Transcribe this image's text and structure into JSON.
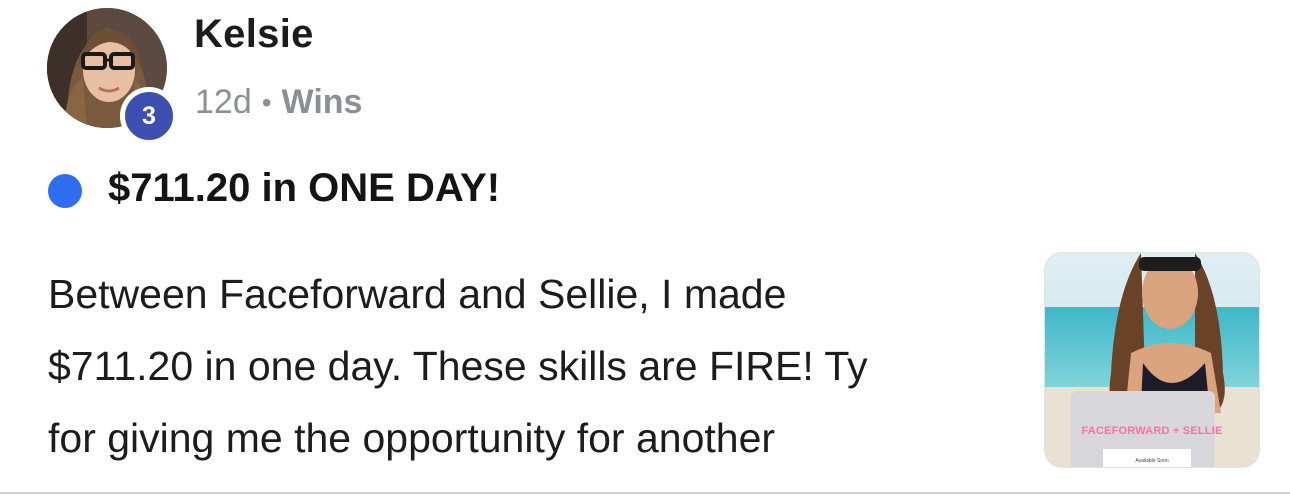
{
  "post": {
    "author": {
      "name": "Kelsie",
      "level": "3"
    },
    "meta": {
      "time": "12d",
      "separator": "•",
      "category": "Wins"
    },
    "title": "$711.20 in ONE DAY!",
    "body_lines": [
      "Between Faceforward and Sellie, I made",
      "$711.20 in one day. These skills are FIRE! Ty",
      "for giving me the opportunity for another"
    ],
    "thumbnail": {
      "brand_text": "FACEFORWARD + SELLIE",
      "sub_text": "Available Soon"
    }
  },
  "colors": {
    "unread_dot": "#2f6ef0",
    "level_badge": "#3d4fb0",
    "meta_text": "#8d8f95",
    "thumbnail_brand": "#ff6fa6"
  }
}
